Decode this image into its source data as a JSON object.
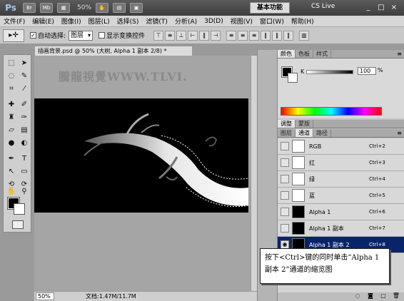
{
  "app": {
    "logo": "Ps",
    "app_buttons": [
      "Br",
      "Mb"
    ],
    "zoom": "50%",
    "workspace": "基本功能",
    "cs_live": "CS Live",
    "window_controls": [
      "_",
      "□",
      "×"
    ]
  },
  "menu": [
    "文件(F)",
    "编辑(E)",
    "图像(I)",
    "图层(L)",
    "选择(S)",
    "滤镜(T)",
    "分析(A)",
    "3D(D)",
    "视图(V)",
    "窗口(W)",
    "帮助(H)"
  ],
  "options": {
    "auto_select_label": "自动选择:",
    "auto_select_value": "图层",
    "show_transform_label": "显示变换控件"
  },
  "document": {
    "tab_title": "插画背景.psd @ 50% (大树, Alpha 1 副本 2/8) *",
    "watermark": "騰龍視覺WWW.TLVI.",
    "zoom": "50%",
    "doc_size": "文档:1.47M/11.7M"
  },
  "color_panel": {
    "tabs": [
      "颜色",
      "色板",
      "样式"
    ],
    "channel_label": "K",
    "k_value": "100",
    "k_unit": "%"
  },
  "channels_panel": {
    "tabs": [
      "调整",
      "蒙版"
    ],
    "tabs2": [
      "图层",
      "通道",
      "路径"
    ],
    "rows": [
      {
        "name": "RGB",
        "shortcut": "Ctrl+2"
      },
      {
        "name": "红",
        "shortcut": "Ctrl+3"
      },
      {
        "name": "绿",
        "shortcut": "Ctrl+4"
      },
      {
        "name": "蓝",
        "shortcut": "Ctrl+5"
      },
      {
        "name": "Alpha 1",
        "shortcut": "Ctrl+6"
      },
      {
        "name": "Alpha 1 副本",
        "shortcut": "Ctrl+7"
      },
      {
        "name": "Alpha 1 副本 2",
        "shortcut": "Ctrl+8"
      }
    ]
  },
  "callout": {
    "text": "按下<Ctrl>键的同时单击“Alpha 1 副本 2”通道的缩览图"
  }
}
